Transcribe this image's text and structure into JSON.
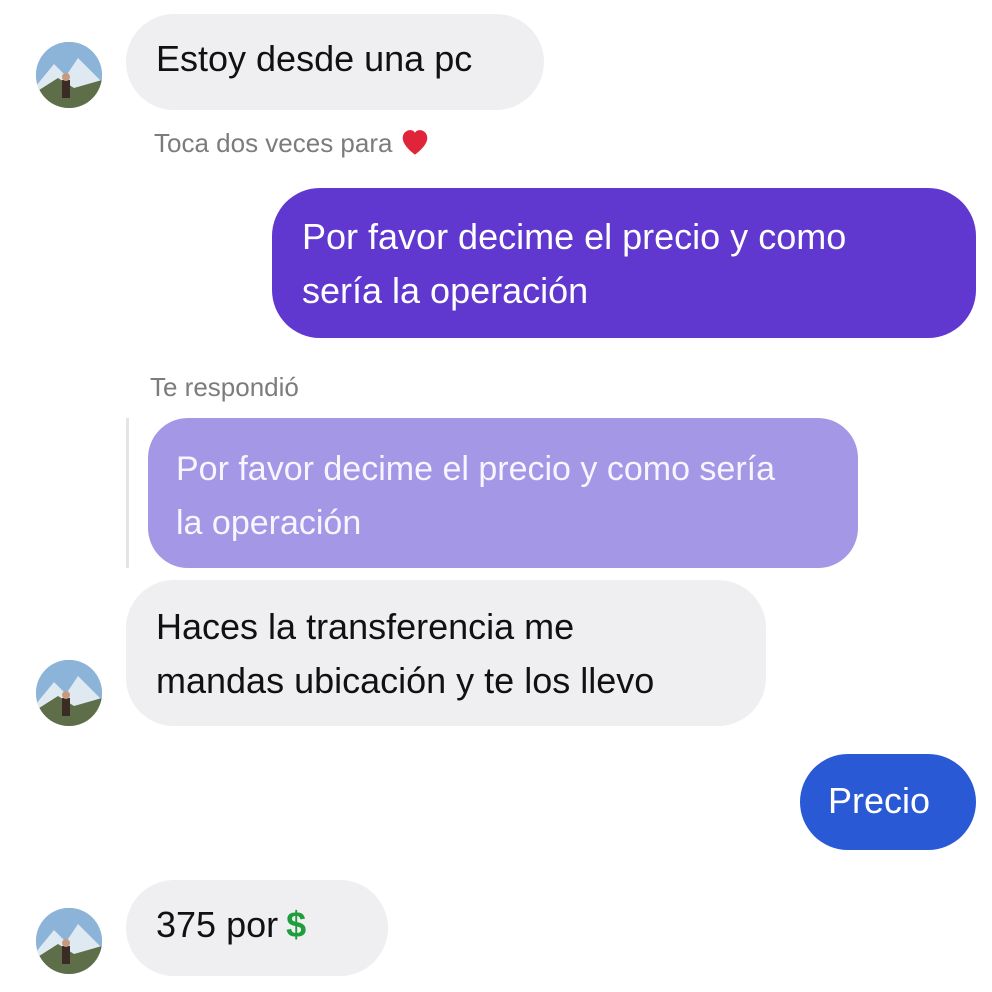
{
  "messages": {
    "m1": {
      "text": "Estoy desde una pc"
    },
    "m1_hint": "Toca dos veces para",
    "m2": {
      "line1": "Por favor decime el precio y como",
      "line2": "sería la operación"
    },
    "reply_label": "Te respondió",
    "reply_quote": {
      "line1": "Por favor decime el precio y como sería",
      "line2": "la operación"
    },
    "m3": {
      "line1": "Haces la transferencia me",
      "line2": "mandas ubicación y te los llevo"
    },
    "m4": {
      "text": "Precio"
    },
    "m5": {
      "text": "375 por",
      "emoji": "$"
    }
  },
  "icons": {
    "heart": "heart-icon",
    "dollar": "dollar-sign-icon",
    "avatar": "contact-avatar"
  },
  "colors": {
    "incoming_bubble": "#efeff1",
    "outgoing_purple": "#6038d0",
    "outgoing_blue": "#2a59d6",
    "quote_bubble": "#a497e6",
    "heart": "#e0243a",
    "dollar": "#1f9d3d"
  }
}
